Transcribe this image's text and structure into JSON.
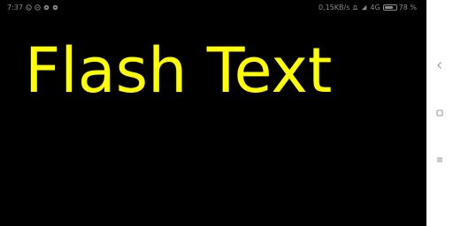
{
  "status_bar": {
    "time": "7:37",
    "network_speed": "0,15KB/s",
    "network_type": "4G",
    "battery_percent": "78 %",
    "battery_level": 0.78,
    "icons": [
      "whatsapp-icon",
      "sync-icon",
      "location-icon",
      "messenger-icon",
      "alarm-icon",
      "signal-icon"
    ]
  },
  "main": {
    "flash_text": "Flash Text",
    "text_color": "#ffff00",
    "background_color": "#000000"
  },
  "nav_bar": {
    "background_color": "#ffffff",
    "buttons": [
      "back-icon",
      "home-icon",
      "menu-icon"
    ]
  }
}
